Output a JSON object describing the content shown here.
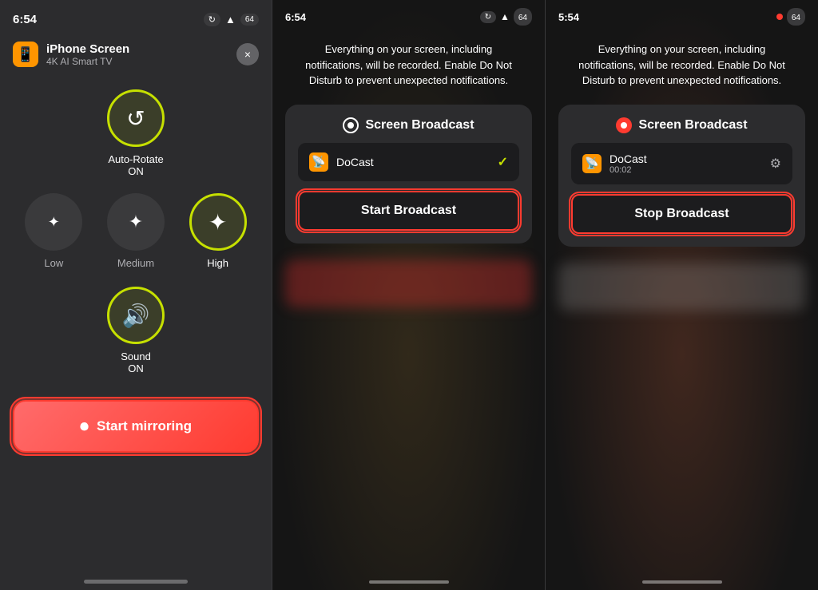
{
  "panel1": {
    "status_time": "6:54",
    "device_name": "iPhone Screen",
    "device_subtitle": "4K AI Smart TV",
    "device_icon": "📱",
    "brightness_label_line1": "Auto-Rotate",
    "brightness_label_line2": "ON",
    "quality_items": [
      {
        "label": "Low",
        "active": false
      },
      {
        "label": "Medium",
        "active": false
      },
      {
        "label": "High",
        "active": true
      }
    ],
    "sound_label_line1": "Sound",
    "sound_label_line2": "ON",
    "start_mirroring_label": "Start mirroring",
    "close_label": "×"
  },
  "panel2": {
    "status_time": "6:54",
    "warning_text": "Everything on your screen, including notifications, will be recorded. Enable Do Not Disturb to prevent unexpected notifications.",
    "dialog_title": "Screen Broadcast",
    "dialog_item_name": "DoCast",
    "start_broadcast_label": "Start Broadcast",
    "checkmark": "✓"
  },
  "panel3": {
    "status_time": "5:54",
    "warning_text": "Everything on your screen, including notifications, will be recorded. Enable Do Not Disturb to prevent unexpected notifications.",
    "dialog_title": "Screen Broadcast",
    "dialog_item_name": "DoCast",
    "dialog_item_sub": "00:02",
    "stop_broadcast_label": "Stop Broadcast"
  }
}
